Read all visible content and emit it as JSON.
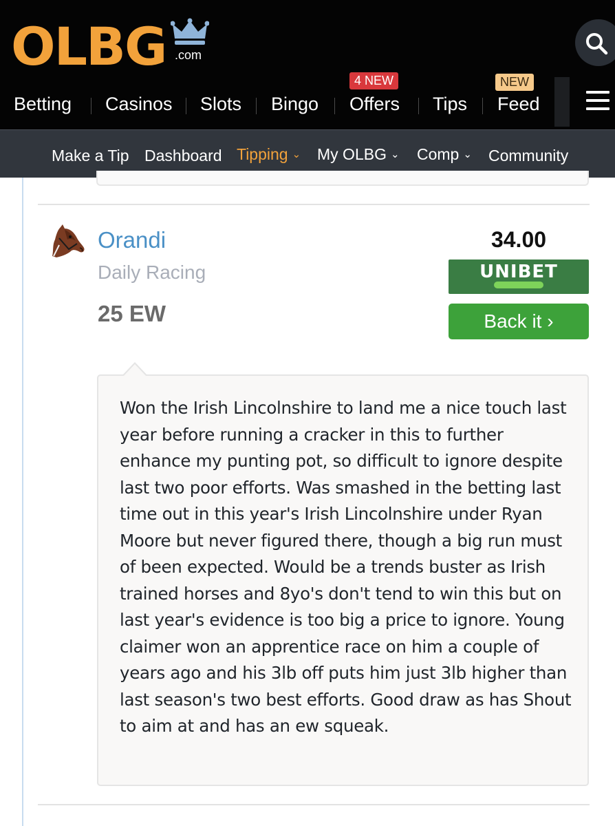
{
  "header": {
    "logo": {
      "main": "OLBG",
      "suffix": ".com"
    },
    "search_icon": "search-icon",
    "nav": [
      {
        "label": "Betting"
      },
      {
        "label": "Casinos"
      },
      {
        "label": "Slots"
      },
      {
        "label": "Bingo"
      },
      {
        "label": "Offers",
        "badge": "4 NEW"
      },
      {
        "label": "Tips"
      },
      {
        "label": "Feed",
        "badge": "NEW"
      }
    ],
    "menu_icon": "hamburger-icon"
  },
  "subnav": {
    "items": [
      {
        "label": "Make a Tip"
      },
      {
        "label": "Dashboard"
      },
      {
        "label": "Tipping",
        "active": true,
        "dropdown": true
      },
      {
        "label": "My OLBG",
        "dropdown": true
      },
      {
        "label": "Comp",
        "dropdown": true
      },
      {
        "label": "Community"
      }
    ]
  },
  "tip": {
    "avatar_icon": "horse-head-icon",
    "tipster": "Orandi",
    "category": "Daily Racing",
    "stake": "25 EW",
    "odds": "34.00",
    "bookmaker": "UNIBET",
    "back_label": "Back it ›",
    "comment": "Won the Irish Lincolnshire to land me a nice touch last year before running a cracker in this to further enhance my punting pot, so difficult to ignore despite last two poor efforts. Was smashed in the betting last time out in this year's Irish Lincolnshire under Ryan Moore but never figured there, though a big run must of been expected. Would be a trends buster as Irish trained horses and 8yo's don't tend to win this but on last year's evidence is too big a price to ignore. Young claimer won an apprentice race on him a couple of years ago and his 3lb off puts him just 3lb higher than last season's two best efforts. Good draw as has Shout to aim at and has an ew squeak."
  },
  "colors": {
    "brand_orange": "#f2a23b",
    "header_bg": "#040404",
    "subnav_bg": "#31363d",
    "link_blue": "#4a90c6",
    "unibet_green": "#3a7d44",
    "back_green": "#3da23a"
  }
}
